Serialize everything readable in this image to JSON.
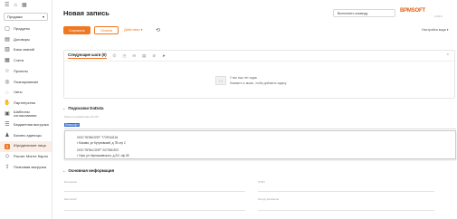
{
  "sidebar": {
    "company": "Продажи",
    "items": [
      {
        "label": "Продукты",
        "icon": "box-icon"
      },
      {
        "label": "Договоры",
        "icon": "document-icon"
      },
      {
        "label": "База знаний",
        "icon": "book-icon"
      },
      {
        "label": "Счета",
        "icon": "invoice-icon"
      },
      {
        "label": "Проекты",
        "icon": "star-icon"
      },
      {
        "label": "Планирование",
        "icon": "check-circle-icon"
      },
      {
        "label": "Чаты",
        "icon": "chat-icon"
      },
      {
        "label": "Партнерства",
        "icon": "handshake-icon"
      },
      {
        "label": "Шаблоны согласования",
        "icon": "template-icon"
      },
      {
        "label": "Бюджетная выгрузка",
        "icon": "database-icon"
      },
      {
        "label": "Бизнес-единицы",
        "icon": "people-icon"
      },
      {
        "label": "Юридические лица",
        "icon": "legal-entity-icon"
      },
      {
        "label": "Расчет Монте Карло",
        "icon": "dice-icon"
      },
      {
        "label": "Плановая выгрузка",
        "icon": "upload-icon"
      }
    ]
  },
  "header": {
    "title": "Новая запись",
    "command_placeholder": "Выполнить команду",
    "logo": "BPMSOFT",
    "logo_sub": "1.6.0.0",
    "save": "Сохранить",
    "cancel": "Отмена",
    "actions": "Действия ▾",
    "view_settings": "Настройка вида ▾"
  },
  "next_steps": {
    "tab": "Следующие шаги (0)",
    "empty_line1": "У вас еще нет задач",
    "empty_line2": "Нажмите ⊕ выше, чтобы добавить задачу"
  },
  "dadata": {
    "title": "Подсказки DaData",
    "field_label": "Поиск по реквизитам или ИП",
    "field_value": "бпмсофт",
    "suggestions": [
      {
        "name": "ООО \"БПМСОФТ\" 7729744134",
        "address": "г Москва, ул Кутузовский, д 7В стр 2"
      },
      {
        "name": "ООО \"БПМ-СОФТ\" 0273941572",
        "address": "г Уфа, ул Чернышевского, д 2/2, оф 28"
      }
    ]
  },
  "basic_info": {
    "title": "Основная информация",
    "left_fields": [
      "Контрагент",
      "Категория*"
    ],
    "right_fields": [
      "ОГРН",
      "Контур филиалов"
    ]
  }
}
